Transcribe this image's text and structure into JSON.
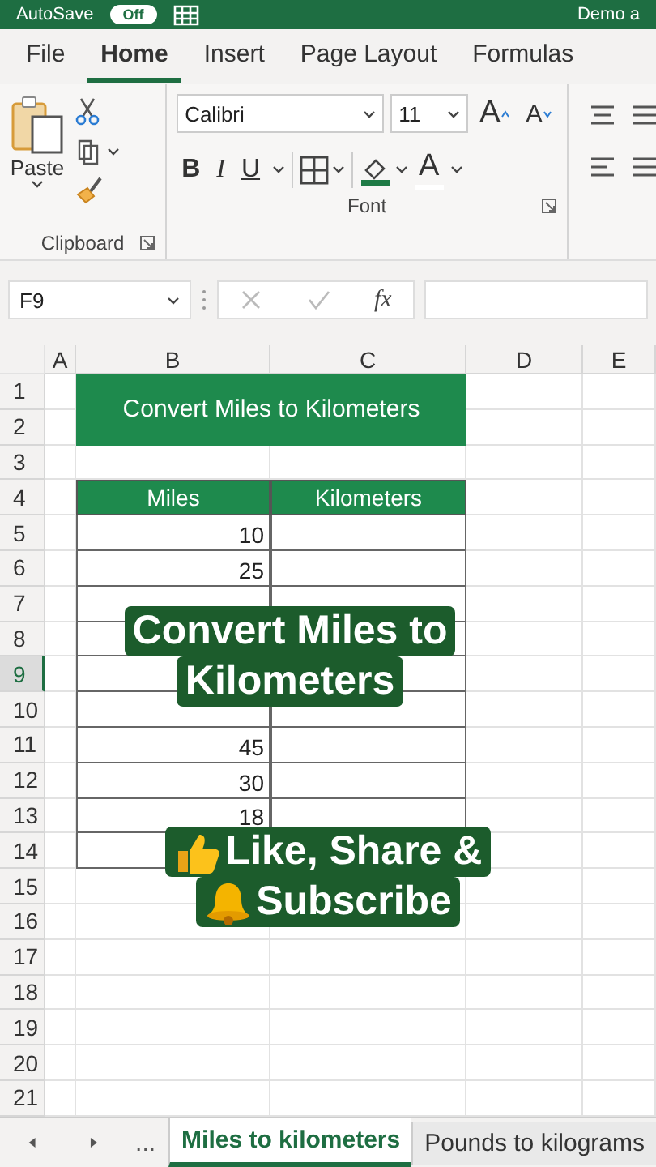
{
  "title_bar": {
    "autosave_label": "AutoSave",
    "autosave_toggle": "Off",
    "file_name": "Demo a"
  },
  "ribbon_tabs": [
    {
      "label": "File",
      "selected": false
    },
    {
      "label": "Home",
      "selected": true
    },
    {
      "label": "Insert",
      "selected": false
    },
    {
      "label": "Page Layout",
      "selected": false
    },
    {
      "label": "Formulas",
      "selected": false
    }
  ],
  "ribbon": {
    "clipboard": {
      "paste_label": "Paste",
      "group_label": "Clipboard"
    },
    "font": {
      "font_name": "Calibri",
      "font_size": "11",
      "bold": "B",
      "italic": "I",
      "underline": "U",
      "grow": "A",
      "shrink": "A",
      "font_color": "A",
      "group_label": "Font"
    }
  },
  "formula_bar": {
    "name_box": "F9",
    "function_label": "fx"
  },
  "sheet": {
    "columns": [
      "A",
      "B",
      "C",
      "D",
      "E"
    ],
    "rows": [
      {
        "number": "1",
        "selected": false
      },
      {
        "number": "2",
        "selected": false
      },
      {
        "number": "3",
        "selected": false
      },
      {
        "number": "4",
        "selected": false
      },
      {
        "number": "5",
        "selected": false,
        "miles": "10"
      },
      {
        "number": "6",
        "selected": false,
        "miles": "25"
      },
      {
        "number": "7",
        "selected": false
      },
      {
        "number": "8",
        "selected": false
      },
      {
        "number": "9",
        "selected": true
      },
      {
        "number": "10",
        "selected": false
      },
      {
        "number": "11",
        "selected": false,
        "miles": "45"
      },
      {
        "number": "12",
        "selected": false,
        "miles": "30"
      },
      {
        "number": "13",
        "selected": false,
        "miles": "18"
      },
      {
        "number": "14",
        "selected": false
      },
      {
        "number": "15",
        "selected": false
      },
      {
        "number": "16",
        "selected": false
      },
      {
        "number": "17",
        "selected": false
      },
      {
        "number": "18",
        "selected": false
      },
      {
        "number": "19",
        "selected": false
      },
      {
        "number": "20",
        "selected": false
      },
      {
        "number": "21",
        "selected": false
      }
    ],
    "title": "Convert Miles to Kilometers",
    "headers": [
      "Miles",
      "Kilometers"
    ]
  },
  "captions": [
    {
      "kind": "title",
      "lines": [
        "Convert Miles to",
        "Kilometers"
      ]
    },
    {
      "kind": "cta",
      "lines": [
        "Like, Share &",
        "Subscribe"
      ]
    }
  ],
  "sheet_tabs": {
    "overflow": "...",
    "tabs": [
      {
        "label": "Miles to kilometers",
        "selected": true
      },
      {
        "label": "Pounds to kilograms",
        "selected": false
      }
    ]
  }
}
